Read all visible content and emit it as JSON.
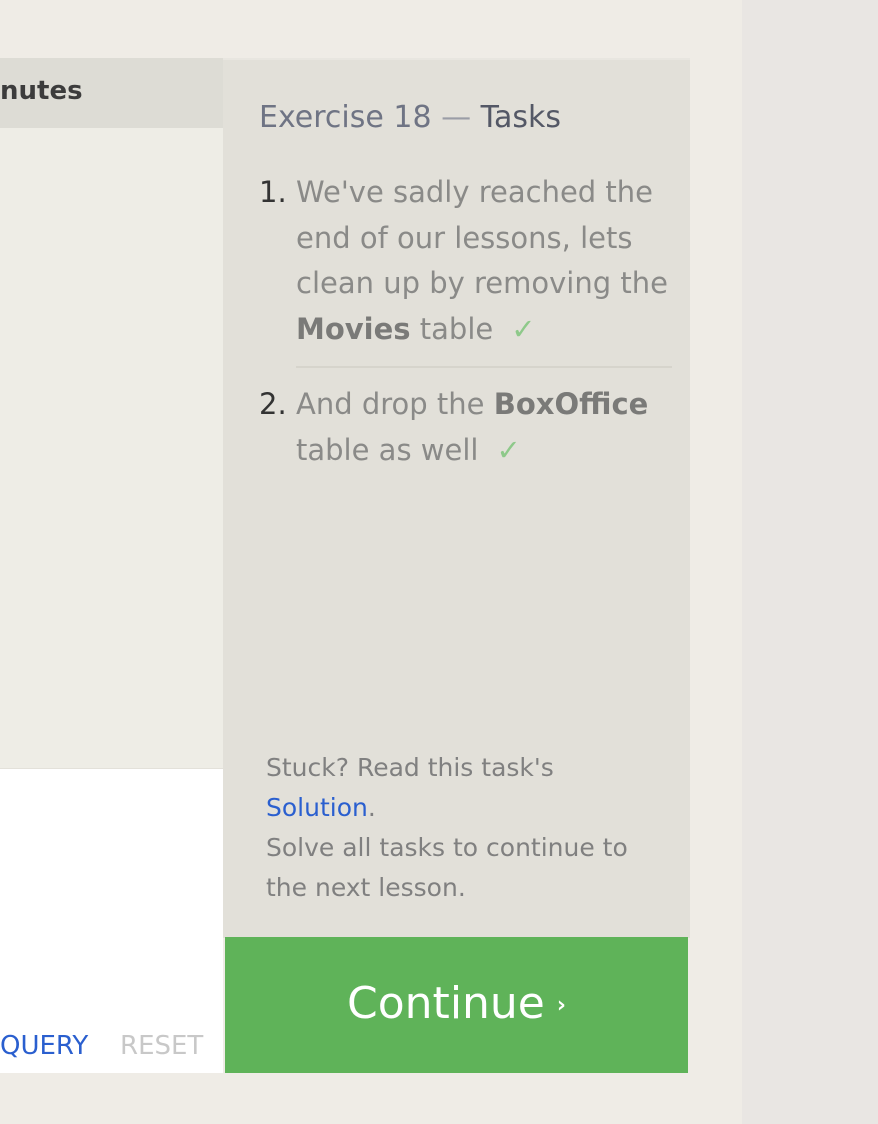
{
  "results": {
    "column_header": "nutes"
  },
  "editor": {
    "run_query_label": "QUERY",
    "reset_label": "RESET"
  },
  "tasks_panel": {
    "title_prefix": "Exercise 18",
    "title_separator": "—",
    "title_suffix": "Tasks",
    "tasks": [
      {
        "number": "1.",
        "text_before": "We've sadly reached the end of our lessons, lets clean up by removing the ",
        "bold": "Movies",
        "text_after": " table",
        "completed": true,
        "check": "✓"
      },
      {
        "number": "2.",
        "text_before": "And drop the ",
        "bold": "BoxOffice",
        "text_after": " table as well",
        "completed": true,
        "check": "✓"
      }
    ],
    "help": {
      "stuck_text": "Stuck? Read this task's",
      "solution_link": "Solution",
      "period": ".",
      "solve_text": "Solve all tasks to continue to the next lesson."
    }
  },
  "continue_button": {
    "label": "Continue",
    "chevron": "›"
  },
  "colors": {
    "page_bg": "#efece6",
    "tasks_bg": "#e2e0d9",
    "continue_bg": "#5fb359",
    "link": "#2a5fcf",
    "check": "#8ec98a"
  },
  "icons": {
    "check": "check-icon",
    "continue": "chevron-right-icon"
  }
}
